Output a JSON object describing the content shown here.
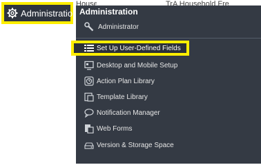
{
  "nav": {
    "label": "Administration",
    "icon": "gear-icon"
  },
  "background": {
    "left_text": "Household",
    "right_text": "TrA  Household Fre"
  },
  "menu": {
    "title": "Administration",
    "admin_item": "Administrator",
    "items": [
      {
        "label": "Set Up User-Defined Fields",
        "icon": "list-icon",
        "highlighted": true
      },
      {
        "label": "Desktop and Mobile Setup",
        "icon": "desktop-icon"
      },
      {
        "label": "Action Plan Library",
        "icon": "clock-icon"
      },
      {
        "label": "Template Library",
        "icon": "template-icon"
      },
      {
        "label": "Notification Manager",
        "icon": "speech-bubble-icon"
      },
      {
        "label": "Web Forms",
        "icon": "form-icon"
      },
      {
        "label": "Version & Storage Space",
        "icon": "storage-icon"
      }
    ]
  },
  "colors": {
    "highlight": "#ffee00",
    "panel": "#343a44",
    "nav": "#2f3540"
  }
}
